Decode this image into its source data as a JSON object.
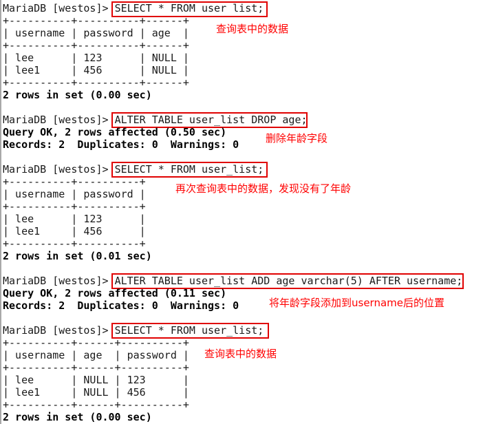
{
  "terminal": {
    "prompt": "MariaDB [westos]> ",
    "blocks": [
      {
        "command": "SELECT * FROM user list;",
        "table_border": "+----------+----------+------+",
        "header": "| username | password | age  |",
        "rows": [
          "| lee      | 123      | NULL |",
          "| lee1     | 456      | NULL |"
        ],
        "result": "2 rows in set (0.00 sec)",
        "annotation": "查询表中的数据"
      },
      {
        "command": "ALTER TABLE user_list DROP age;",
        "result_lines": [
          "Query OK, 2 rows affected (0.50 sec)",
          "Records: 2  Duplicates: 0  Warnings: 0"
        ],
        "annotation": "删除年龄字段"
      },
      {
        "command": "SELECT * FROM user_list;",
        "table_border": "+----------+----------+",
        "header": "| username | password |",
        "rows": [
          "| lee      | 123      |",
          "| lee1     | 456      |"
        ],
        "result": "2 rows in set (0.01 sec)",
        "annotation": "再次查询表中的数据，发现没有了年龄"
      },
      {
        "command": "ALTER TABLE user_list ADD age varchar(5) AFTER username;",
        "result_lines": [
          "Query OK, 2 rows affected (0.11 sec)",
          "Records: 2  Duplicates: 0  Warnings: 0"
        ],
        "annotation": "将年龄字段添加到username后的位置"
      },
      {
        "command": "SELECT * FROM user_list;",
        "table_border": "+----------+------+----------+",
        "header": "| username | age  | password |",
        "rows": [
          "| lee      | NULL | 123      |",
          "| lee1     | NULL | 456      |"
        ],
        "result": "2 rows in set (0.00 sec)",
        "annotation": "查询表中的数据"
      }
    ]
  },
  "colors": {
    "highlight_box": "#e00000",
    "annotation_text": "#ff0000"
  }
}
